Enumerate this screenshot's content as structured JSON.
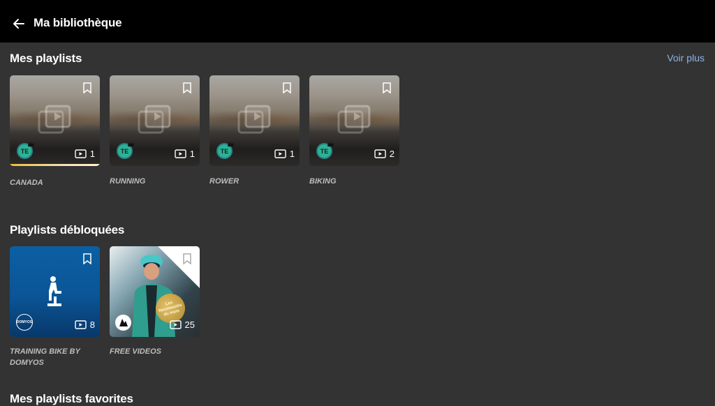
{
  "header": {
    "title": "Ma bibliothèque"
  },
  "my_playlists": {
    "title": "Mes playlists",
    "voir_plus": "Voir plus",
    "items": [
      {
        "name": "CANADA",
        "count": "1",
        "avatar": "TE"
      },
      {
        "name": "RUNNING",
        "count": "1",
        "avatar": "TE"
      },
      {
        "name": "ROWER",
        "count": "1",
        "avatar": "TE"
      },
      {
        "name": "BIKING",
        "count": "2",
        "avatar": "TE"
      }
    ]
  },
  "unlocked": {
    "title": "Playlists débloquées",
    "items": [
      {
        "name": "TRAINING BIKE BY DOMYOS",
        "count": "8",
        "logo": "DOMYOS"
      },
      {
        "name": "FREE VIDEOS",
        "count": "25",
        "badge": "Les Nouveautés du mois"
      }
    ]
  },
  "favorites": {
    "title": "Mes playlists favorites"
  },
  "colors": {
    "accent_link": "#8db4e6",
    "avatar_bg": "#2bb392",
    "background": "#333333"
  },
  "icons": [
    "back-arrow-icon",
    "bookmark-icon",
    "video-placeholder-icon",
    "play-count-icon",
    "crown-icon"
  ]
}
